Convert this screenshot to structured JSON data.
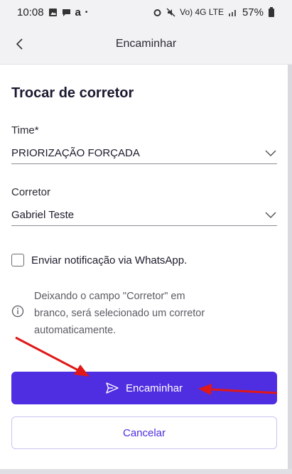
{
  "status_bar": {
    "time": "10:08",
    "notif_letter": "a",
    "network": "Vo) 4G LTE",
    "battery": "57%"
  },
  "header": {
    "title": "Encaminhar"
  },
  "form": {
    "title": "Trocar de corretor",
    "team": {
      "label": "Time*",
      "value": "PRIORIZAÇÃO FORÇADA"
    },
    "broker": {
      "label": "Corretor",
      "value": "Gabriel Teste"
    },
    "whatsapp_checkbox": {
      "label": "Enviar notificação via WhatsApp.",
      "checked": false
    },
    "info_lines": [
      "Deixando o campo \"Corretor\" em",
      "branco, será selecionado um corretor",
      "automaticamente."
    ]
  },
  "actions": {
    "forward_label": "Encaminhar",
    "cancel_label": "Cancelar"
  },
  "colors": {
    "primary": "#4f2de0",
    "annotation_arrow": "#e01818"
  }
}
